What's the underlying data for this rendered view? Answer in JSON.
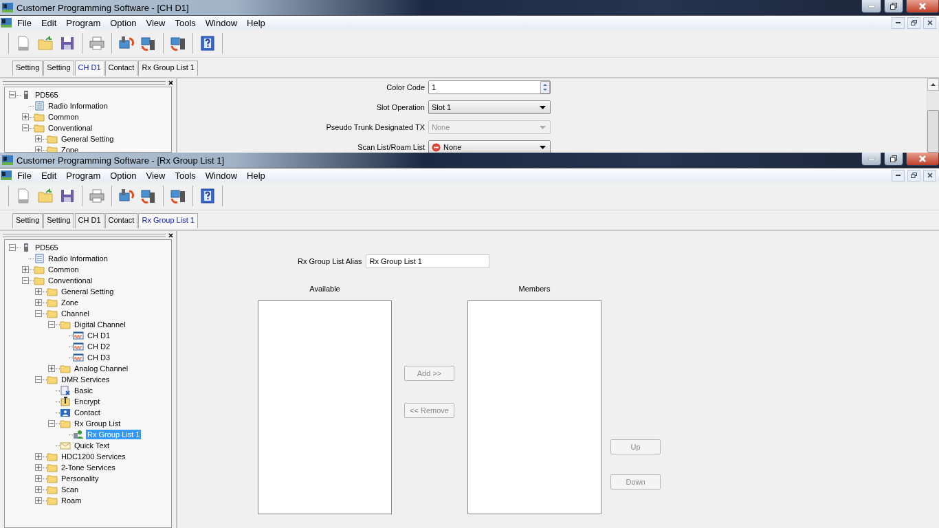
{
  "windows": [
    {
      "title": "Customer Programming Software - [CH D1]",
      "menu": [
        "File",
        "Edit",
        "Program",
        "Option",
        "View",
        "Tools",
        "Window",
        "Help"
      ],
      "tabs": [
        {
          "label": "Setting",
          "selected": false
        },
        {
          "label": "Setting",
          "selected": false
        },
        {
          "label": "CH D1",
          "selected": true
        },
        {
          "label": "Contact",
          "selected": false
        },
        {
          "label": "Rx Group List 1",
          "selected": false
        }
      ],
      "tree": [
        {
          "label": "PD565",
          "kind": "device",
          "expanded": true,
          "selected": false,
          "children": [
            {
              "label": "Radio Information",
              "kind": "info",
              "selected": false
            },
            {
              "label": "Common",
              "kind": "folder",
              "expanded": false,
              "selected": false
            },
            {
              "label": "Conventional",
              "kind": "folder",
              "expanded": true,
              "selected": false,
              "children": [
                {
                  "label": "General Setting",
                  "kind": "folder",
                  "expanded": false,
                  "selected": false
                },
                {
                  "label": "Zone",
                  "kind": "folder",
                  "expanded": false,
                  "selected": false
                }
              ]
            }
          ]
        }
      ],
      "panel": {
        "kind": "channel",
        "fields": [
          {
            "label": "Color Code",
            "kind": "spin",
            "value": "1",
            "disabled": false
          },
          {
            "label": "Slot Operation",
            "kind": "select",
            "value": "Slot 1",
            "disabled": false
          },
          {
            "label": "Pseudo Trunk Designated TX",
            "kind": "select",
            "value": "None",
            "disabled": true
          },
          {
            "label": "Scan List/Roam List",
            "kind": "stop-select",
            "value": "None",
            "disabled": false
          }
        ]
      }
    },
    {
      "title": "Customer Programming Software - [Rx Group List 1]",
      "menu": [
        "File",
        "Edit",
        "Program",
        "Option",
        "View",
        "Tools",
        "Window",
        "Help"
      ],
      "tabs": [
        {
          "label": "Setting",
          "selected": false
        },
        {
          "label": "Setting",
          "selected": false
        },
        {
          "label": "CH D1",
          "selected": false
        },
        {
          "label": "Contact",
          "selected": false
        },
        {
          "label": "Rx Group List 1",
          "selected": true
        }
      ],
      "tree": [
        {
          "label": "PD565",
          "kind": "device",
          "expanded": true,
          "selected": false,
          "children": [
            {
              "label": "Radio Information",
              "kind": "info",
              "selected": false
            },
            {
              "label": "Common",
              "kind": "folder",
              "expanded": false,
              "selected": false
            },
            {
              "label": "Conventional",
              "kind": "folder",
              "expanded": true,
              "selected": false,
              "children": [
                {
                  "label": "General Setting",
                  "kind": "folder",
                  "expanded": false,
                  "selected": false
                },
                {
                  "label": "Zone",
                  "kind": "folder",
                  "expanded": false,
                  "selected": false
                },
                {
                  "label": "Channel",
                  "kind": "folder",
                  "expanded": true,
                  "selected": false,
                  "children": [
                    {
                      "label": "Digital Channel",
                      "kind": "folder",
                      "expanded": true,
                      "selected": false,
                      "children": [
                        {
                          "label": "CH D1",
                          "kind": "channel",
                          "selected": false
                        },
                        {
                          "label": "CH D2",
                          "kind": "channel",
                          "selected": false
                        },
                        {
                          "label": "CH D3",
                          "kind": "channel",
                          "selected": false
                        }
                      ]
                    },
                    {
                      "label": "Analog Channel",
                      "kind": "folder",
                      "expanded": false,
                      "selected": false
                    }
                  ]
                },
                {
                  "label": "DMR Services",
                  "kind": "folder",
                  "expanded": true,
                  "selected": false,
                  "children": [
                    {
                      "label": "Basic",
                      "kind": "basic",
                      "selected": false
                    },
                    {
                      "label": "Encrypt",
                      "kind": "encrypt",
                      "selected": false
                    },
                    {
                      "label": "Contact",
                      "kind": "contact",
                      "selected": false
                    },
                    {
                      "label": "Rx Group List",
                      "kind": "folder",
                      "expanded": true,
                      "selected": false,
                      "children": [
                        {
                          "label": "Rx Group List 1",
                          "kind": "group",
                          "selected": true
                        }
                      ]
                    },
                    {
                      "label": "Quick Text",
                      "kind": "text",
                      "selected": false
                    }
                  ]
                },
                {
                  "label": "HDC1200 Services",
                  "kind": "folder",
                  "expanded": false,
                  "selected": false
                },
                {
                  "label": "2-Tone Services",
                  "kind": "folder",
                  "expanded": false,
                  "selected": false
                },
                {
                  "label": "Personality",
                  "kind": "folder",
                  "expanded": false,
                  "selected": false
                },
                {
                  "label": "Scan",
                  "kind": "folder",
                  "expanded": false,
                  "selected": false
                },
                {
                  "label": "Roam",
                  "kind": "folder",
                  "expanded": false,
                  "selected": false
                }
              ]
            }
          ]
        }
      ],
      "panel": {
        "kind": "group",
        "alias_label": "Rx Group List Alias",
        "alias_value": "Rx Group List 1",
        "available_label": "Available",
        "members_label": "Members",
        "move_buttons": [
          {
            "label": "Add >>",
            "disabled": true
          },
          {
            "label": "<< Remove",
            "disabled": true
          }
        ],
        "order_buttons": [
          {
            "label": "Up",
            "disabled": true
          },
          {
            "label": "Down",
            "disabled": true
          }
        ]
      }
    }
  ]
}
